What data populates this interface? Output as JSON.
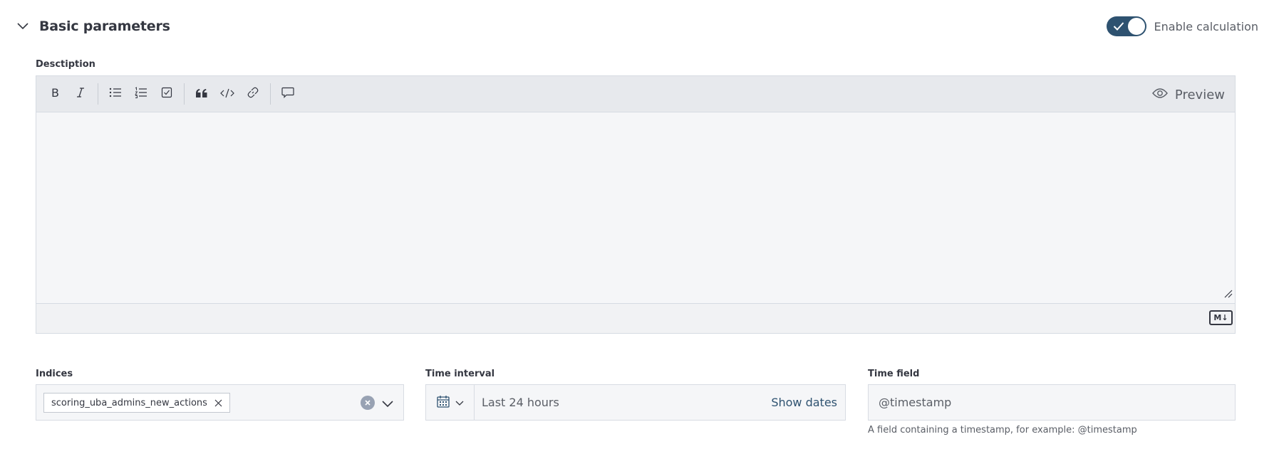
{
  "section": {
    "title": "Basic parameters"
  },
  "toggle": {
    "label": "Enable calculation",
    "checked": true
  },
  "description": {
    "label": "Desctiption",
    "preview_label": "Preview",
    "value": "",
    "markdown_badge": "M↓",
    "toolbar_icons": [
      "bold-icon",
      "italic-icon",
      "bullet-list-icon",
      "numbered-list-icon",
      "checklist-icon",
      "quote-icon",
      "code-icon",
      "link-icon",
      "comment-icon"
    ]
  },
  "indices": {
    "label": "Indices",
    "selected": [
      "scoring_uba_admins_new_actions"
    ]
  },
  "time_interval": {
    "label": "Time interval",
    "value": "Last 24 hours",
    "show_dates_label": "Show dates"
  },
  "time_field": {
    "label": "Time field",
    "value": "@timestamp",
    "help_text": "A field containing a timestamp, for example: @timestamp"
  },
  "colors": {
    "accent": "#2e5270",
    "toolbar_bg": "#e7e9ed",
    "field_bg": "#f5f6f8"
  }
}
